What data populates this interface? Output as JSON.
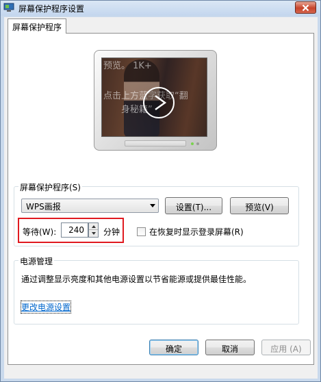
{
  "window": {
    "title": "屏幕保护程序设置",
    "close_icon": "close-icon"
  },
  "tab": {
    "label": "屏幕保护程序"
  },
  "preview": {
    "screen_text_1": "预览。 1K+",
    "screen_text_2": "点击上方蓝字获取“翻",
    "screen_text_3": "身秘籍”",
    "play_icon": "play-icon"
  },
  "screensaver_group": {
    "legend": "屏幕保护程序(S)",
    "selected": "WPS画报",
    "settings_button": "设置(T)...",
    "preview_button": "预览(V)",
    "wait_label": "等待(W):",
    "wait_value": "240",
    "minutes_label": "分钟",
    "resume_checkbox_label": "在恢复时显示登录屏幕(R)",
    "resume_checked": false
  },
  "power_group": {
    "legend": "电源管理",
    "description": "通过调整显示亮度和其他电源设置以节省能源或提供最佳性能。",
    "link": "更改电源设置"
  },
  "buttons": {
    "ok": "确定",
    "cancel": "取消",
    "apply": "应用 (A)"
  },
  "colors": {
    "highlight": "#e0191f",
    "link": "#0066cc",
    "close_button": "#c6432a"
  }
}
